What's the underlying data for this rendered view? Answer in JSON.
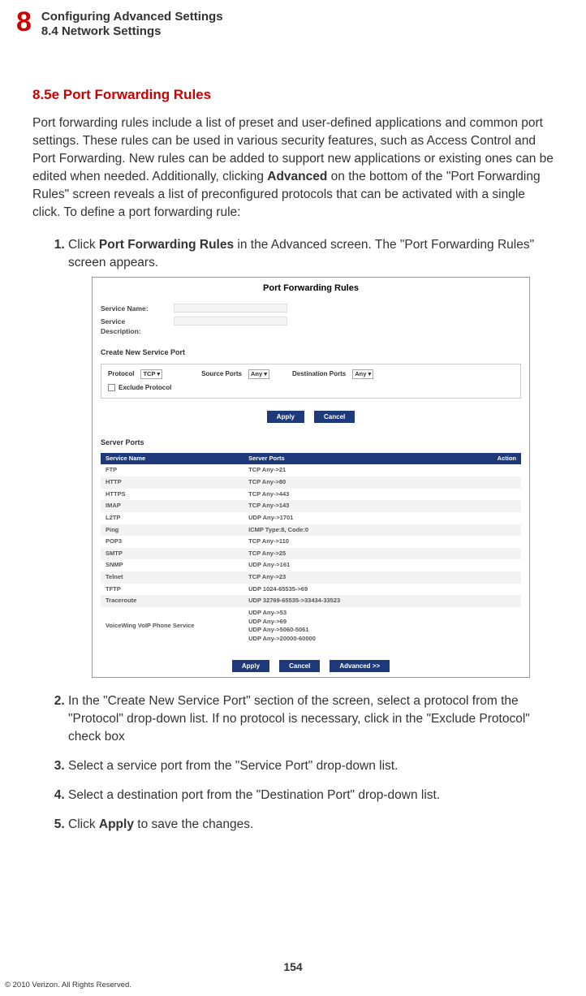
{
  "chapter_number": "8",
  "header_title": "Configuring Advanced Settings",
  "header_subtitle": "8.4  Network Settings",
  "section_title": "8.5e  Port Forwarding Rules",
  "intro_p1": "Port forwarding rules include a list of preset and user-defined applications and common port settings. These rules can be used in various security features, such as Access Control and Port Forwarding. New rules can be added to support new applications or existing ones can be edited when needed.  Additionally, clicking ",
  "intro_bold": "Advanced",
  "intro_p2": " on the bottom of the \"Port Forwarding Rules\" screen reveals a list of preconfigured protocols that can be activated with a single click. To define a port forwarding rule:",
  "steps": [
    {
      "pre": "Click ",
      "bold": "Port Forwarding Rules",
      "post": " in the Advanced screen. The \"Port Forwarding Rules\" screen appears."
    },
    {
      "pre": "In the \"Create New Service Port\" section of the screen, select a protocol from the \"Protocol\" drop-down list.  If no protocol is necessary, click in the \"Exclude Protocol\" check box",
      "bold": "",
      "post": ""
    },
    {
      "pre": "Select a service port from the \"Service Port\" drop-down list.",
      "bold": "",
      "post": ""
    },
    {
      "pre": "Select a destination port from the \"Destination Port\" drop-down list.",
      "bold": "",
      "post": ""
    },
    {
      "pre": "Click ",
      "bold": "Apply",
      "post": " to save the changes."
    }
  ],
  "screenshot": {
    "title": "Port Forwarding Rules",
    "service_name_label": "Service Name:",
    "service_desc_label": "Service Description:",
    "create_header": "Create New Service Port",
    "protocol_label": "Protocol",
    "protocol_value": "TCP ▾",
    "source_ports_label": "Source Ports",
    "source_ports_value": "Any ▾",
    "dest_ports_label": "Destination Ports",
    "dest_ports_value": "Any ▾",
    "exclude_label": "Exclude Protocol",
    "apply_btn": "Apply",
    "cancel_btn": "Cancel",
    "advanced_btn": "Advanced >>",
    "server_ports_header": "Server Ports",
    "cols": {
      "name": "Service Name",
      "ports": "Server Ports",
      "action": "Action"
    },
    "rows": [
      {
        "name": "FTP",
        "ports": "TCP Any->21"
      },
      {
        "name": "HTTP",
        "ports": "TCP Any->80"
      },
      {
        "name": "HTTPS",
        "ports": "TCP Any->443"
      },
      {
        "name": "IMAP",
        "ports": "TCP Any->143"
      },
      {
        "name": "L2TP",
        "ports": "UDP Any->1701"
      },
      {
        "name": "Ping",
        "ports": "ICMP Type:8, Code:0"
      },
      {
        "name": "POP3",
        "ports": "TCP Any->110"
      },
      {
        "name": "SMTP",
        "ports": "TCP Any->25"
      },
      {
        "name": "SNMP",
        "ports": "UDP Any->161"
      },
      {
        "name": "Telnet",
        "ports": "TCP Any->23"
      },
      {
        "name": "TFTP",
        "ports": "UDP 1024-65535->69"
      },
      {
        "name": "Traceroute",
        "ports": "UDP 32769-65535->33434-33523"
      },
      {
        "name": "VoiceWing VoIP Phone Service",
        "ports": "UDP Any->53\nUDP Any->69\nUDP Any->5060-5061\nUDP Any->20000-60000"
      }
    ]
  },
  "page_number": "154",
  "copyright": "© 2010 Verizon. All Rights Reserved."
}
